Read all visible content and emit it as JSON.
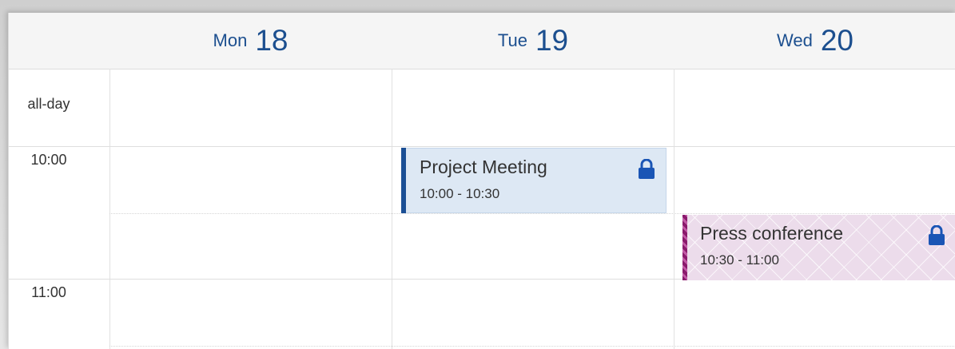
{
  "header": {
    "days": [
      {
        "name": "Mon",
        "num": "18"
      },
      {
        "name": "Tue",
        "num": "19"
      },
      {
        "name": "Wed",
        "num": "20"
      }
    ]
  },
  "axis": {
    "allday": "all-day",
    "t1000": "10:00",
    "t1100": "11:00"
  },
  "events": {
    "meeting": {
      "title": "Project Meeting",
      "time": "10:00 - 10:30",
      "color": "#1b4f95",
      "icon": "lock-icon"
    },
    "press": {
      "title": "Press conference",
      "time": "10:30 - 11:00",
      "color": "#8a1a6c",
      "icon": "lock-icon"
    }
  },
  "colors": {
    "accent": "#1c4f8f",
    "lock": "#1a55b5"
  }
}
